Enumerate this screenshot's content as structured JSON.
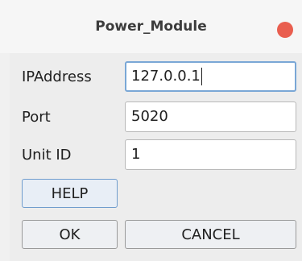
{
  "window": {
    "title": "Power_Module",
    "close_color": "#e95e4f"
  },
  "form": {
    "ip": {
      "label": "IPAddress",
      "value": "127.0.0.1"
    },
    "port": {
      "label": "Port",
      "value": "5020"
    },
    "unit": {
      "label": "Unit ID",
      "value": "1"
    }
  },
  "buttons": {
    "help": "HELP",
    "ok": "OK",
    "cancel": "CANCEL"
  }
}
